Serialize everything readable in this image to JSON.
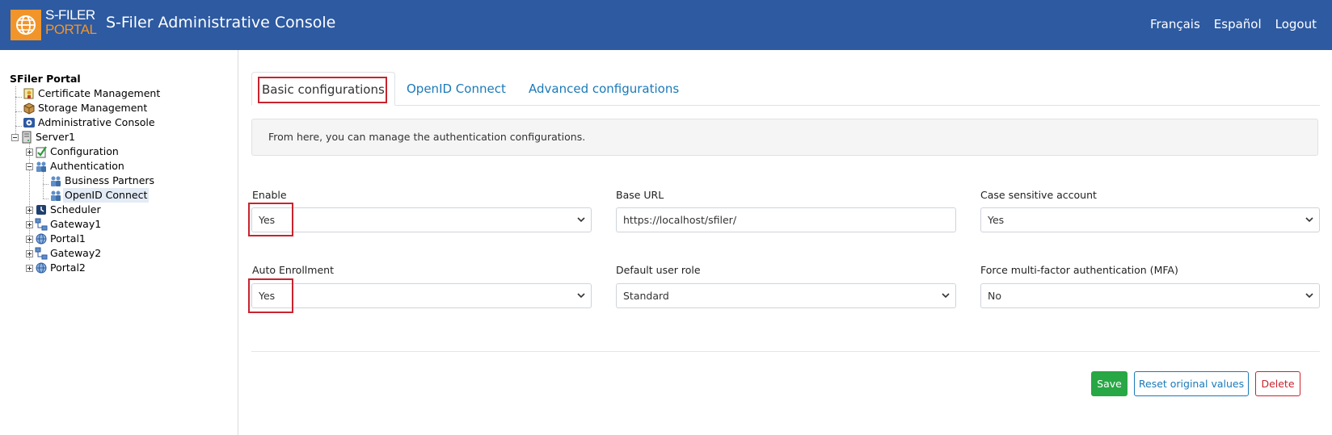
{
  "header": {
    "logo_line1": "S-FILER",
    "logo_line2": "PORTAL",
    "title": "S-Filer Administrative Console",
    "nav": [
      "Français",
      "Español",
      "Logout"
    ]
  },
  "sidebar": {
    "root": "SFiler Portal",
    "items": [
      {
        "label": "Certificate Management",
        "icon": "certificate-icon"
      },
      {
        "label": "Storage Management",
        "icon": "storage-box-icon"
      },
      {
        "label": "Administrative Console",
        "icon": "admin-console-icon"
      },
      {
        "label": "Server1",
        "icon": "server-icon",
        "expanded": true
      },
      {
        "label": "Configuration",
        "icon": "configuration-icon"
      },
      {
        "label": "Authentication",
        "icon": "users-icon",
        "expanded": true
      },
      {
        "label": "Business Partners",
        "icon": "users-icon"
      },
      {
        "label": "OpenID Connect",
        "icon": "users-icon",
        "selected": true
      },
      {
        "label": "Scheduler",
        "icon": "scheduler-icon"
      },
      {
        "label": "Gateway1",
        "icon": "gateway-icon"
      },
      {
        "label": "Portal1",
        "icon": "portal-icon"
      },
      {
        "label": "Gateway2",
        "icon": "gateway-icon"
      },
      {
        "label": "Portal2",
        "icon": "portal-icon"
      }
    ]
  },
  "tabs": [
    "Basic configurations",
    "OpenID Connect",
    "Advanced configurations"
  ],
  "info_text": "From here, you can manage the authentication configurations.",
  "form": {
    "enable": {
      "label": "Enable",
      "value": "Yes"
    },
    "base_url": {
      "label": "Base URL",
      "value": "https://localhost/sfiler/"
    },
    "case_sensitive": {
      "label": "Case sensitive account",
      "value": "Yes"
    },
    "auto_enrollment": {
      "label": "Auto Enrollment",
      "value": "Yes"
    },
    "default_role": {
      "label": "Default user role",
      "value": "Standard"
    },
    "force_mfa": {
      "label": "Force multi-factor authentication (MFA)",
      "value": "No"
    }
  },
  "buttons": {
    "save": "Save",
    "reset": "Reset original values",
    "delete": "Delete"
  },
  "colors": {
    "header": "#2d5aa1",
    "brand_orange": "#f1952b",
    "link": "#1a7ab9",
    "highlight": "#c8242f",
    "save": "#28a745"
  }
}
